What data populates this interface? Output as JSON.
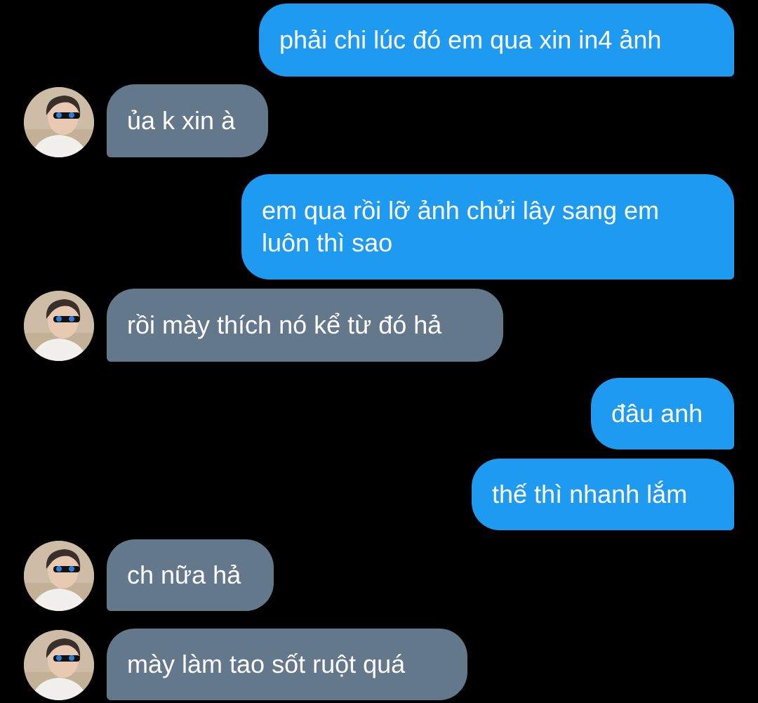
{
  "colors": {
    "background": "#000000",
    "sent_bubble": "#1e9bf0",
    "received_bubble": "#64788c",
    "text": "#ffffff"
  },
  "avatar_icon": "profile-photo-sunglasses",
  "messages": [
    {
      "from": "me",
      "text": "phải chi lúc đó em qua xin in4 ảnh"
    },
    {
      "from": "other",
      "text": "ủa k xin à"
    },
    {
      "from": "me",
      "text": "em qua rồi lỡ ảnh chửi lây sang em luôn thì sao"
    },
    {
      "from": "other",
      "text": "rồi mày thích nó kể từ đó hả"
    },
    {
      "from": "me",
      "text": "đâu anh"
    },
    {
      "from": "me",
      "text": "thế thì nhanh lắm"
    },
    {
      "from": "other",
      "text": "ch nữa hả"
    },
    {
      "from": "other",
      "text": "mày làm tao sốt ruột quá"
    }
  ]
}
